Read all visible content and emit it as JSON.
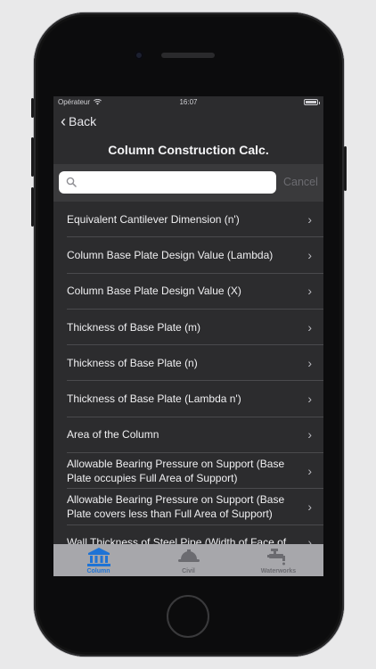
{
  "status_bar": {
    "carrier": "Opérateur",
    "time": "16:07"
  },
  "nav": {
    "back_label": "Back"
  },
  "title": "Column Construction Calc.",
  "search": {
    "value": "",
    "placeholder": "",
    "cancel_label": "Cancel"
  },
  "list": {
    "items": [
      {
        "label": "Equivalent Cantilever Dimension (n')"
      },
      {
        "label": "Column Base Plate Design Value (Lambda)"
      },
      {
        "label": "Column Base Plate Design Value (X)"
      },
      {
        "label": "Thickness of Base Plate (m)"
      },
      {
        "label": "Thickness of Base Plate (n)"
      },
      {
        "label": "Thickness of Base Plate (Lambda n')"
      },
      {
        "label": "Area of the Column"
      },
      {
        "label": "Allowable Bearing Pressure on Support (Base Plate occupies Full Area of Support)"
      },
      {
        "label": "Allowable Bearing Pressure on Support (Base Plate covers less than Full Area of Support)"
      },
      {
        "label": "Wall Thickness of Steel Pipe (Width of Face of"
      }
    ]
  },
  "tabs": [
    {
      "label": "Column",
      "icon": "column-building-icon",
      "active": true,
      "color": "#1e73d6"
    },
    {
      "label": "Civil",
      "icon": "hard-hat-icon",
      "active": false,
      "color": "#6b6b70"
    },
    {
      "label": "Waterworks",
      "icon": "faucet-icon",
      "active": false,
      "color": "#6b6b70"
    }
  ],
  "colors": {
    "screen_bg": "#2c2c2e",
    "search_bg": "#3a3a3c",
    "tab_bar_bg": "#a7a7ab",
    "active_tab": "#1e73d6"
  }
}
